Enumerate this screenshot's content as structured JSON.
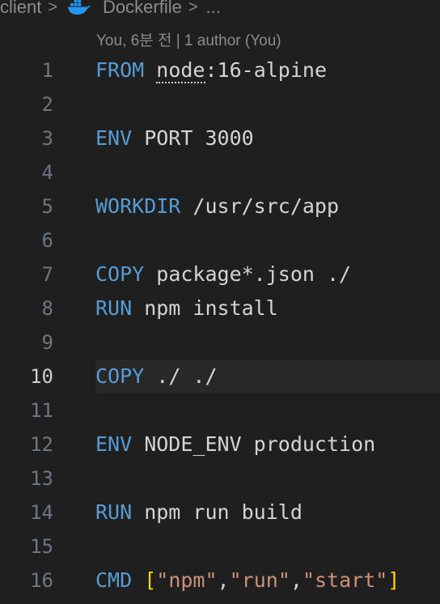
{
  "breadcrumb": {
    "folder": "client",
    "file": "Dockerfile",
    "more": "...",
    "separator": ">"
  },
  "codelens": "You, 6분 전 | 1 author (You)",
  "colors": {
    "background": "#1f1f1f",
    "keyword": "#569cd6",
    "text": "#d4d4d4",
    "string": "#ce9178",
    "bracket": "#ffd700",
    "line_number": "#6e7681",
    "current_line_bg": "#282828"
  },
  "current_line": 10,
  "lines": [
    {
      "n": "1",
      "kw": "FROM",
      "rest_pre": " ",
      "ul": "node",
      "rest": ":16-alpine"
    },
    {
      "n": "2"
    },
    {
      "n": "3",
      "kw": "ENV",
      "rest": " PORT 3000"
    },
    {
      "n": "4"
    },
    {
      "n": "5",
      "kw": "WORKDIR",
      "rest": " /usr/src/app"
    },
    {
      "n": "6"
    },
    {
      "n": "7",
      "kw": "COPY",
      "rest": " package*.json ./"
    },
    {
      "n": "8",
      "kw": "RUN",
      "rest": " npm install"
    },
    {
      "n": "9"
    },
    {
      "n": "10",
      "kw": "COPY",
      "rest": " ./ ./"
    },
    {
      "n": "11"
    },
    {
      "n": "12",
      "kw": "ENV",
      "rest": " NODE_ENV production"
    },
    {
      "n": "13"
    },
    {
      "n": "14",
      "kw": "RUN",
      "rest": " npm run build"
    },
    {
      "n": "15"
    },
    {
      "n": "16",
      "kw": "CMD",
      "rest": " ",
      "array": [
        "\"npm\"",
        "\"run\"",
        "\"start\""
      ]
    }
  ]
}
